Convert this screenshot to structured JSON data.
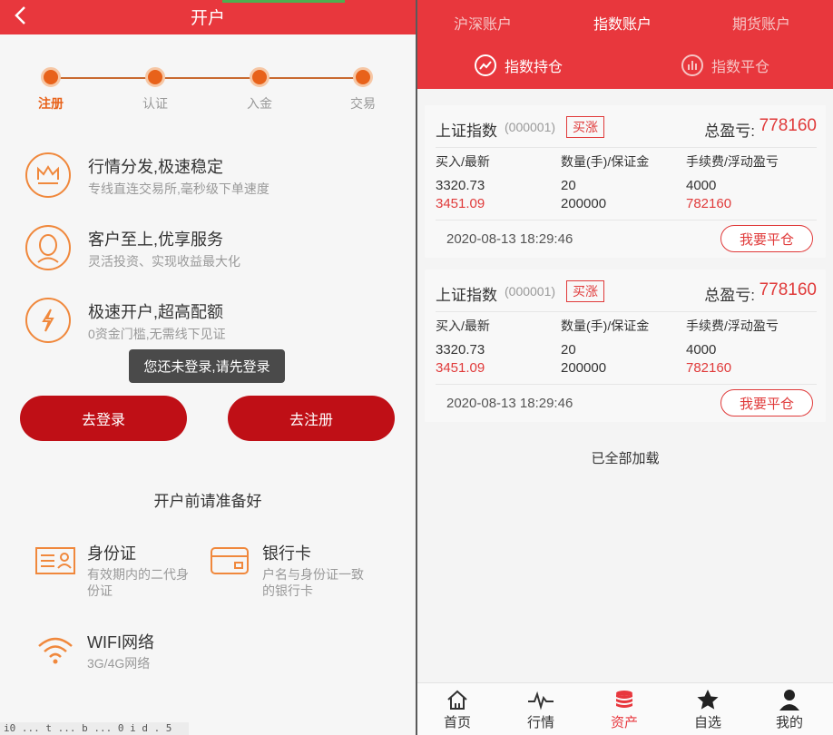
{
  "left": {
    "header_title": "开户",
    "steps": [
      {
        "label": "注册",
        "active": true
      },
      {
        "label": "认证",
        "active": false
      },
      {
        "label": "入金",
        "active": false
      },
      {
        "label": "交易",
        "active": false
      }
    ],
    "features": [
      {
        "title": "行情分发,极速稳定",
        "desc": "专线直连交易所,毫秒级下单速度",
        "icon": "crown-icon"
      },
      {
        "title": "客户至上,优享服务",
        "desc": "灵活投资、实现收益最大化",
        "icon": "user-icon"
      },
      {
        "title": "极速开户,超高配额",
        "desc": "0资金门槛,无需线下见证",
        "icon": "lightning-icon"
      }
    ],
    "toast": "您还未登录,请先登录",
    "login_button": "去登录",
    "register_button": "去注册",
    "prep_title": "开户前请准备好",
    "prep_items": [
      {
        "title": "身份证",
        "desc": "有效期内的二代身份证",
        "icon": "id-card-icon"
      },
      {
        "title": "银行卡",
        "desc": "户名与身份证一致的银行卡",
        "icon": "bank-card-icon"
      },
      {
        "title": "WIFI网络",
        "desc": "3G/4G网络",
        "icon": "wifi-icon"
      }
    ],
    "bottom_code": "i0 ... t ... b ... 0 i d . 5"
  },
  "right": {
    "tabs": [
      {
        "label": "沪深账户",
        "active": false
      },
      {
        "label": "指数账户",
        "active": true
      },
      {
        "label": "期货账户",
        "active": false
      }
    ],
    "subtabs": [
      {
        "label": "指数持仓",
        "active": true,
        "icon": "chart-up-icon"
      },
      {
        "label": "指数平仓",
        "active": false,
        "icon": "bar-chart-icon"
      }
    ],
    "columns": {
      "c1": "买入/最新",
      "c2": "数量(手)/保证金",
      "c3": "手续费/浮动盈亏"
    },
    "total_pl_label": "总盈亏:",
    "close_label": "我要平仓",
    "positions": [
      {
        "name": "上证指数",
        "code": "(000001)",
        "direction": "买涨",
        "total_pl": "778160",
        "buy": "3320.73",
        "latest": "3451.09",
        "qty": "20",
        "margin": "200000",
        "fee": "4000",
        "float_pl": "782160",
        "time": "2020-08-13 18:29:46"
      },
      {
        "name": "上证指数",
        "code": "(000001)",
        "direction": "买涨",
        "total_pl": "778160",
        "buy": "3320.73",
        "latest": "3451.09",
        "qty": "20",
        "margin": "200000",
        "fee": "4000",
        "float_pl": "782160",
        "time": "2020-08-13 18:29:46"
      }
    ],
    "loaded_text": "已全部加载",
    "nav": [
      {
        "label": "首页",
        "icon": "home-icon",
        "active": false
      },
      {
        "label": "行情",
        "icon": "pulse-icon",
        "active": false
      },
      {
        "label": "资产",
        "icon": "coins-icon",
        "active": true
      },
      {
        "label": "自选",
        "icon": "star-icon",
        "active": false
      },
      {
        "label": "我的",
        "icon": "person-icon",
        "active": false
      }
    ]
  },
  "colors": {
    "brand_red": "#e8373d",
    "button_red": "#bf0f16",
    "accent_orange": "#e8621a",
    "profit_red": "#e03a3a"
  }
}
